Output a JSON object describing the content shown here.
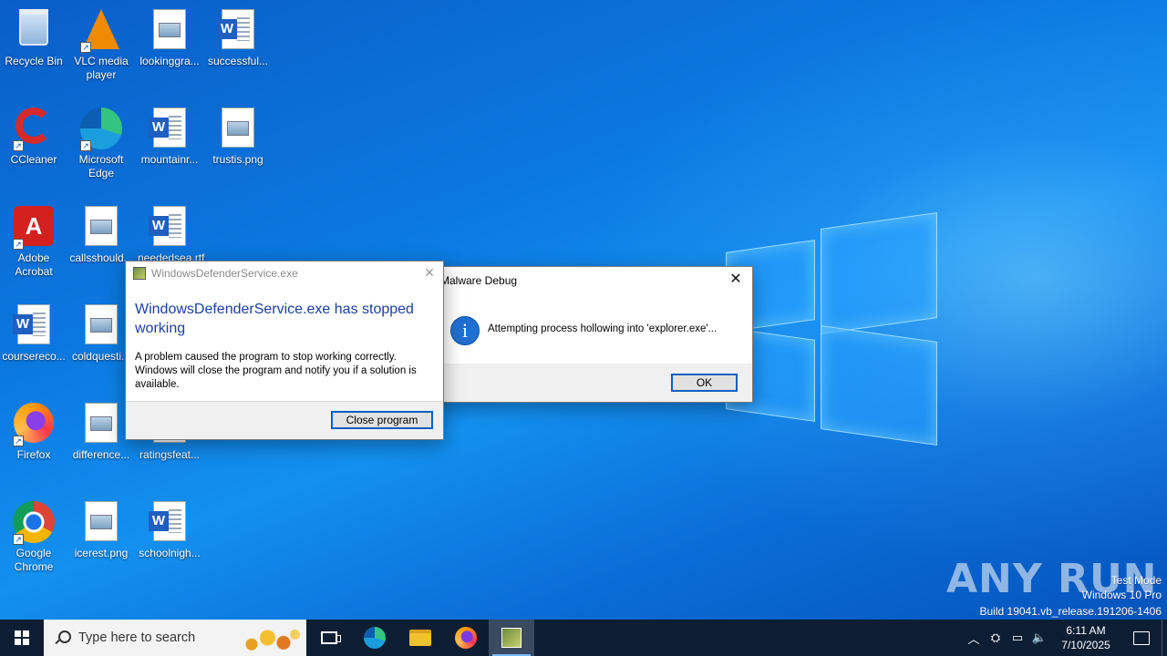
{
  "desktop": {
    "icons": [
      {
        "label": "Recycle Bin",
        "icon": "recycle-bin-icon"
      },
      {
        "label": "VLC media player",
        "icon": "vlc-icon"
      },
      {
        "label": "lookinggra...",
        "icon": "image-file-icon"
      },
      {
        "label": "successful...",
        "icon": "word-doc-icon"
      },
      {
        "label": "CCleaner",
        "icon": "ccleaner-icon"
      },
      {
        "label": "Microsoft Edge",
        "icon": "edge-icon"
      },
      {
        "label": "mountainr...",
        "icon": "word-doc-icon"
      },
      {
        "label": "trustis.png",
        "icon": "image-file-icon"
      },
      {
        "label": "Adobe Acrobat",
        "icon": "acrobat-icon"
      },
      {
        "label": "callsshould...",
        "icon": "image-file-icon"
      },
      {
        "label": "neededsea.rtf",
        "icon": "word-doc-icon"
      },
      {
        "label": "coursereco...",
        "icon": "word-doc-icon"
      },
      {
        "label": "coldquesti...",
        "icon": "image-file-icon"
      },
      {
        "label": "Firefox",
        "icon": "firefox-icon"
      },
      {
        "label": "difference...",
        "icon": "image-file-icon"
      },
      {
        "label": "ratingsfeat...",
        "icon": "image-file-icon"
      },
      {
        "label": "Google Chrome",
        "icon": "chrome-icon"
      },
      {
        "label": "icerest.png",
        "icon": "image-file-icon"
      },
      {
        "label": "schoolnigh...",
        "icon": "word-doc-icon"
      }
    ]
  },
  "wer_dialog": {
    "title": "WindowsDefenderService.exe",
    "heading": "WindowsDefenderService.exe has stopped working",
    "body": "A problem caused the program to stop working correctly. Windows will close the program and notify you if a solution is available.",
    "close_button": "Close program"
  },
  "debug_dialog": {
    "title": "Malware Debug",
    "message": "Attempting process hollowing into 'explorer.exe'...",
    "ok_button": "OK",
    "icon": "info-icon"
  },
  "watermark": {
    "brand": "ANY RUN",
    "line1": "Test Mode",
    "line2": "Windows 10 Pro",
    "line3": "Build 19041.vb_release.191206-1406"
  },
  "taskbar": {
    "search_placeholder": "Type here to search",
    "time": "6:11 AM",
    "date": "7/10/2025",
    "colors": {
      "background": "#0d1e33",
      "accent": "#78b8ff"
    }
  }
}
